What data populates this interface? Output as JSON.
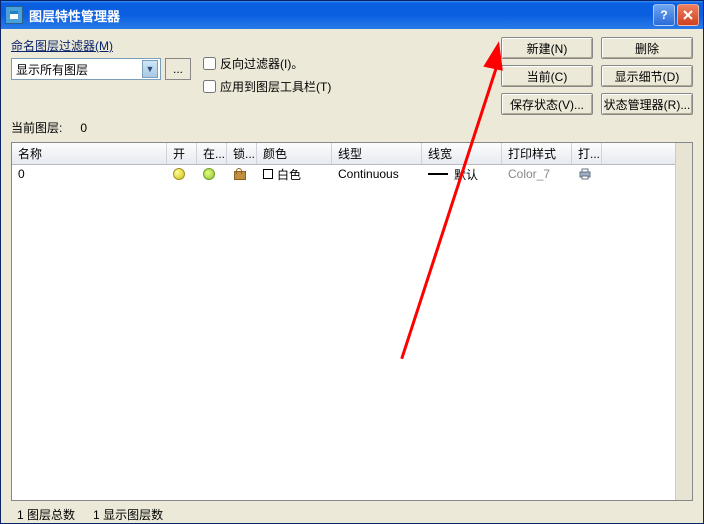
{
  "title": "图层特性管理器",
  "filter": {
    "label": "命名图层过滤器(M)",
    "select_value": "显示所有图层",
    "dots": "...",
    "invert": "反向过滤器(I)。",
    "apply": "应用到图层工具栏(T)"
  },
  "buttons": {
    "new": "新建(N)",
    "delete": "删除",
    "current": "当前(C)",
    "detail": "显示细节(D)",
    "save_state": "保存状态(V)...",
    "state_mgr": "状态管理器(R)..."
  },
  "current_layer": {
    "label": "当前图层:",
    "value": "0"
  },
  "columns": {
    "name": "名称",
    "on": "开",
    "frz": "在...",
    "lock": "锁...",
    "color": "颜色",
    "ltype": "线型",
    "lw": "线宽",
    "pstyle": "打印样式",
    "print": "打..."
  },
  "row": {
    "name": "0",
    "color": "白色",
    "ltype": "Continuous",
    "lw": "默认",
    "pstyle": "Color_7"
  },
  "status": {
    "total_label": "图层总数",
    "total": "1",
    "shown_label": "显示图层数",
    "shown": "1"
  }
}
